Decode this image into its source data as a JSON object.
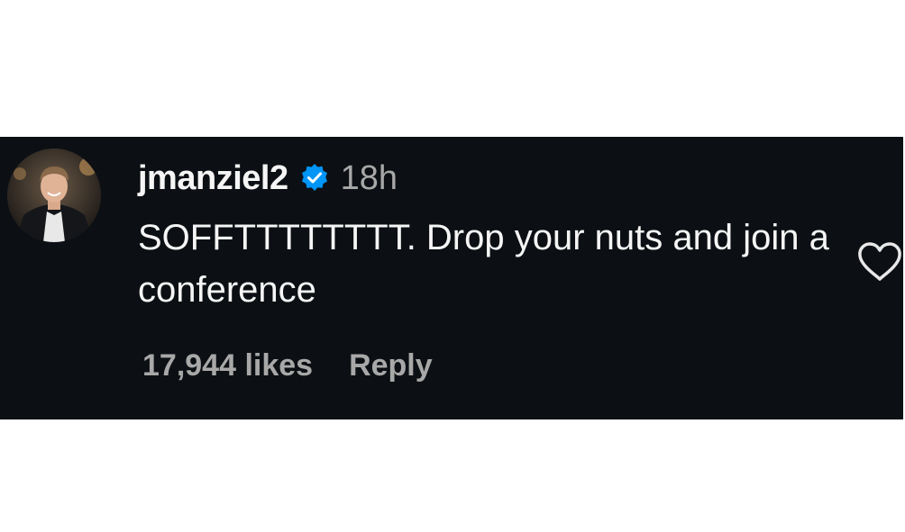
{
  "comment": {
    "username": "jmanziel2",
    "verified": true,
    "timestamp": "18h",
    "text": "SOFFTTTTTTTT. Drop your nuts and join a conference",
    "likes": "17,944 likes",
    "reply_label": "Reply"
  },
  "icons": {
    "verified": "verified-badge-icon",
    "like": "heart-outline-icon"
  },
  "colors": {
    "panel_background": "#0c1014",
    "primary_text": "#f5f5f5",
    "secondary_text": "#a8a8a8",
    "verified_blue": "#0095f6"
  }
}
